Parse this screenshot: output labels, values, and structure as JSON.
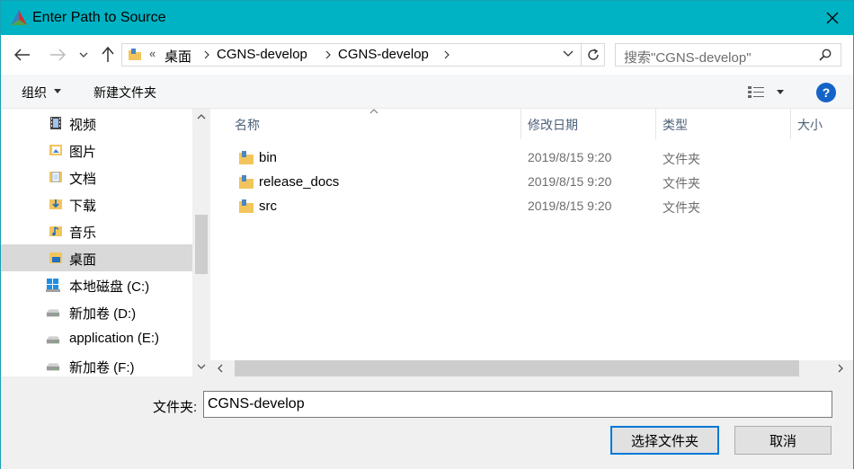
{
  "window": {
    "title": "Enter Path to Source"
  },
  "address": {
    "overflow": "«",
    "crumbs": [
      "桌面",
      "CGNS-develop",
      "CGNS-develop"
    ]
  },
  "search": {
    "placeholder": "搜索\"CGNS-develop\""
  },
  "toolbar": {
    "organize": "组织",
    "new_folder": "新建文件夹"
  },
  "nav": {
    "items": [
      {
        "label": "视频",
        "icon": "video-folder-icon"
      },
      {
        "label": "图片",
        "icon": "pictures-folder-icon"
      },
      {
        "label": "文档",
        "icon": "documents-folder-icon"
      },
      {
        "label": "下载",
        "icon": "downloads-folder-icon"
      },
      {
        "label": "音乐",
        "icon": "music-folder-icon"
      },
      {
        "label": "桌面",
        "icon": "desktop-folder-icon",
        "selected": true
      },
      {
        "label": "本地磁盘 (C:)",
        "icon": "windows-drive-icon"
      },
      {
        "label": "新加卷 (D:)",
        "icon": "drive-icon"
      },
      {
        "label": "application (E:)",
        "icon": "drive-icon"
      },
      {
        "label": "新加卷 (F:)",
        "icon": "drive-icon"
      }
    ]
  },
  "columns": {
    "name": "名称",
    "modified": "修改日期",
    "type": "类型",
    "size": "大小"
  },
  "files": [
    {
      "name": "bin",
      "modified": "2019/8/15 9:20",
      "type": "文件夹"
    },
    {
      "name": "release_docs",
      "modified": "2019/8/15 9:20",
      "type": "文件夹"
    },
    {
      "name": "src",
      "modified": "2019/8/15 9:20",
      "type": "文件夹"
    }
  ],
  "footer": {
    "folder_label": "文件夹:",
    "folder_value": "CGNS-develop",
    "select_button": "选择文件夹",
    "cancel_button": "取消"
  },
  "colors": {
    "titlebar": "#00b3c4",
    "accent": "#0078d7",
    "folder": "#f2c55c",
    "selected": "#d9d9d9"
  }
}
